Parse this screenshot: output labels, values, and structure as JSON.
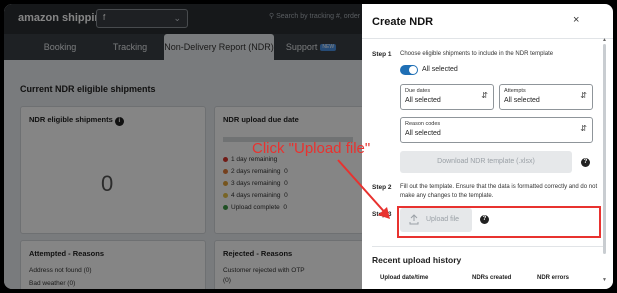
{
  "app": {
    "brand": "amazon shipping",
    "account_value": "f",
    "search_placeholder": "Search by tracking #, order"
  },
  "tabs": [
    {
      "label": "Booking"
    },
    {
      "label": "Tracking"
    },
    {
      "label": "Non-Delivery Report (NDR)",
      "active": true
    },
    {
      "label": "Support",
      "badge": "NEW"
    }
  ],
  "main": {
    "section_title": "Current NDR eligible shipments",
    "eligible_card": {
      "title": "NDR eligible shipments",
      "value": "0"
    },
    "due_card": {
      "title": "NDR upload due date",
      "rows": [
        {
          "label": "1 day remaining",
          "color": "#d9342b"
        },
        {
          "label": "2 days remaining",
          "value": "0",
          "color": "#e07b39"
        },
        {
          "label": "3 days remaining",
          "value": "0",
          "color": "#e3a33a"
        },
        {
          "label": "4 days remaining",
          "value": "0",
          "color": "#e6c14a"
        },
        {
          "label": "Upload complete",
          "value": "0",
          "color": "#3e9a45"
        }
      ]
    },
    "attempted_card": {
      "title": "Attempted - Reasons",
      "rows": [
        "Address not found (0)",
        "Bad weather (0)"
      ]
    },
    "rejected_card": {
      "title": "Rejected - Reasons",
      "rows": [
        "Customer rejected with OTP",
        "(0)"
      ]
    }
  },
  "annotation": {
    "text": "Click \"Upload file\"",
    "color": "#e8322f"
  },
  "panel": {
    "title": "Create NDR",
    "close": "×",
    "step1": {
      "label": "Step 1",
      "text": "Choose eligible shipments to include in the NDR template",
      "toggle_label": "All selected",
      "toggle_on": true,
      "due_dates": {
        "label": "Due dates",
        "value": "All selected"
      },
      "attempts": {
        "label": "Attempts",
        "value": "All selected"
      },
      "reason_codes": {
        "label": "Reason codes",
        "value": "All selected"
      },
      "download_label": "Download NDR template (.xlsx)"
    },
    "step2": {
      "label": "Step 2",
      "text": "Fill out the template. Ensure that the data is formatted correctly and do not make any changes to the template."
    },
    "step3": {
      "label": "Step 3",
      "upload_label": "Upload file"
    },
    "history": {
      "title": "Recent upload history",
      "columns": [
        "Upload date/time",
        "NDRs created",
        "NDR errors"
      ]
    }
  }
}
